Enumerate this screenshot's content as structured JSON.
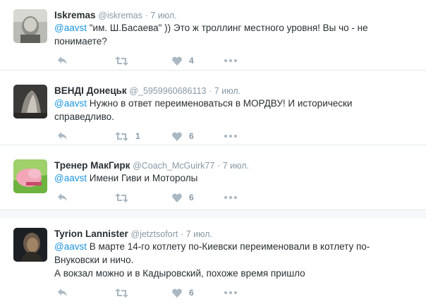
{
  "tweets": [
    {
      "name": "Iskremas",
      "handle": "@iskremas",
      "dot": "·",
      "time": "7 июл.",
      "mention": "@aavst",
      "text_line1": " \"им. Ш.Басаева\" )) Это ж троллинг местного уровня! Вы чо - не",
      "text_line2": "понимаете?",
      "text_line3": "",
      "retweets": "",
      "likes": "4"
    },
    {
      "name": "ВЕНДІ Донецьк",
      "handle": "@_5959960686113",
      "dot": "·",
      "time": "7 июл.",
      "mention": "@aavst",
      "text_line1": " Нужно в ответ переименоваться в МОРДВУ! И исторически",
      "text_line2": "справедливо.",
      "text_line3": "",
      "retweets": "1",
      "likes": "6"
    },
    {
      "name": "Тренер МакГирк",
      "handle": "@Coach_McGuirk77",
      "dot": "·",
      "time": "7 июл.",
      "mention": "@aavst",
      "text_line1": " Имени Гиви и Моторолы",
      "text_line2": "",
      "text_line3": "",
      "retweets": "",
      "likes": "6"
    },
    {
      "name": "Tyrion Lannister",
      "handle": "@jetztsofort",
      "dot": "·",
      "time": "7 июл.",
      "mention": "@aavst",
      "text_line1": " В марте 14-го котлету по-Киевски переименовали в котлету по-",
      "text_line2": "Внуковски и ничо.",
      "text_line3": "А вокзал можно и в Кадыровский, похоже время пришло",
      "retweets": "",
      "likes": "6"
    }
  ],
  "icons": {
    "reply": "reply-icon",
    "retweet": "retweet-icon",
    "like": "heart-icon",
    "more": "more-icon"
  },
  "colors": {
    "mention": "#1b95e0",
    "icon": "#aab8c2",
    "meta": "#8899a6",
    "divider_band": "#f5f8fa"
  }
}
